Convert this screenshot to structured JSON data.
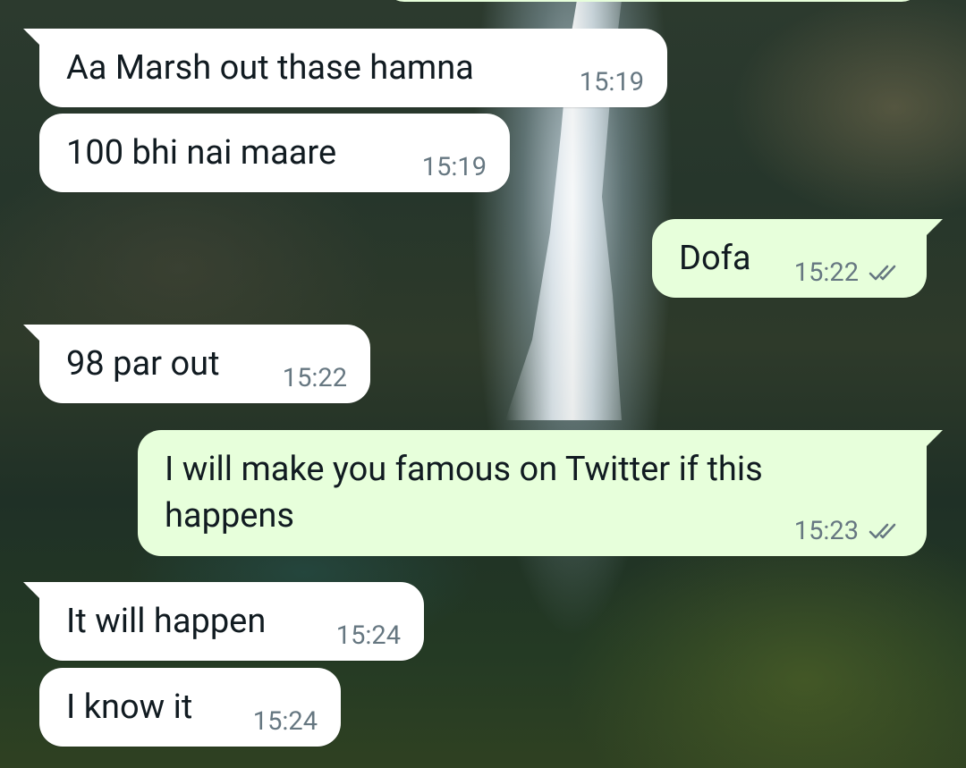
{
  "messages": [
    {
      "direction": "in",
      "text": "Aa Marsh out thase hamna",
      "time": "15:19"
    },
    {
      "direction": "in",
      "text": "100 bhi nai maare",
      "time": "15:19"
    },
    {
      "direction": "out",
      "text": "Dofa",
      "time": "15:22",
      "status": "double-check-icon"
    },
    {
      "direction": "in",
      "text": "98 par out",
      "time": "15:22"
    },
    {
      "direction": "out",
      "text": "I will make you famous on Twitter if this happens",
      "time": "15:23",
      "status": "double-check-icon"
    },
    {
      "direction": "in",
      "text": "It will happen",
      "time": "15:24"
    },
    {
      "direction": "in",
      "text": "I know it",
      "time": "15:24"
    }
  ],
  "colors": {
    "incoming_bubble": "#ffffff",
    "outgoing_bubble": "#e7ffdb",
    "message_text": "#111b21",
    "timestamp": "#667781",
    "tick_color": "#667781"
  }
}
